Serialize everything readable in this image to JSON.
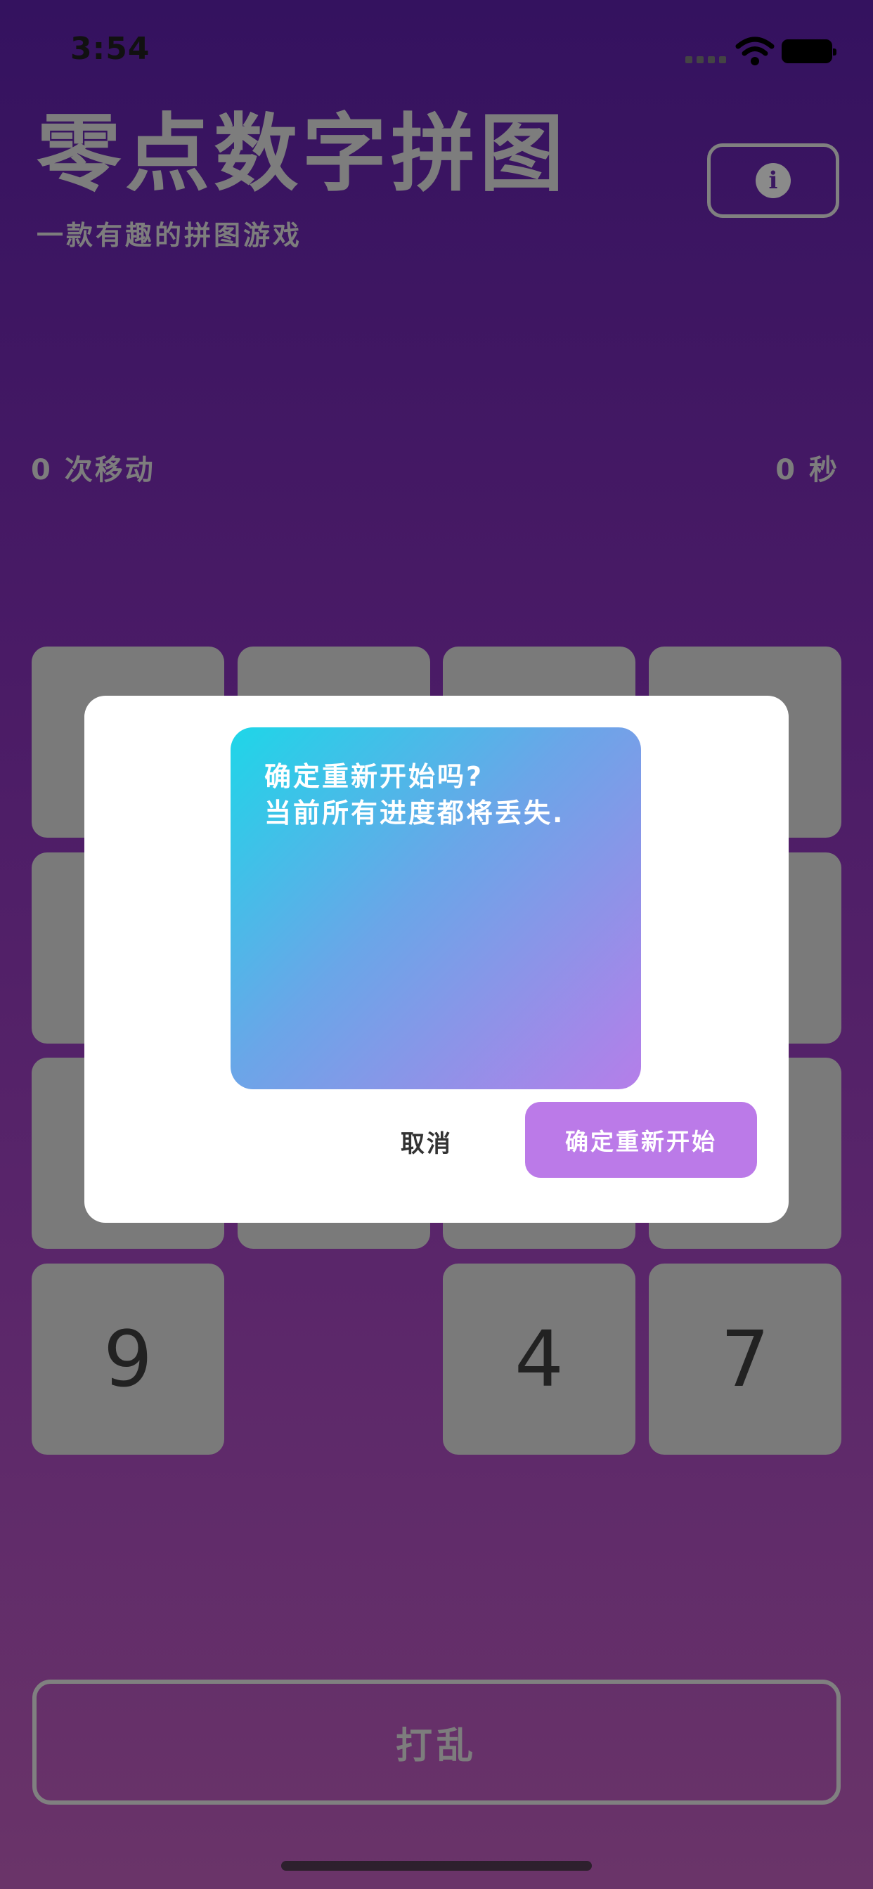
{
  "status_bar": {
    "time": "3:54"
  },
  "header": {
    "title": "零点数字拼图",
    "subtitle": "一款有趣的拼图游戏",
    "info_icon": "info-icon"
  },
  "stats": {
    "moves": "0 次移动",
    "seconds": "0 秒"
  },
  "grid": {
    "visible_tiles": [
      {
        "row": 4,
        "col": 1,
        "label": "9"
      },
      {
        "row": 4,
        "col": 3,
        "label": "4"
      },
      {
        "row": 4,
        "col": 4,
        "label": "7"
      }
    ]
  },
  "dialog": {
    "message_line1": "确定重新开始吗?",
    "message_line2": "当前所有进度都将丢失.",
    "cancel_label": "取消",
    "confirm_label": "确定重新开始"
  },
  "footer": {
    "shuffle_label": "打乱"
  },
  "colors": {
    "background_top": "#34125f",
    "background_bottom": "#6a3469",
    "tile": "#7a7a7a",
    "confirm_button": "#bb7ae8"
  }
}
